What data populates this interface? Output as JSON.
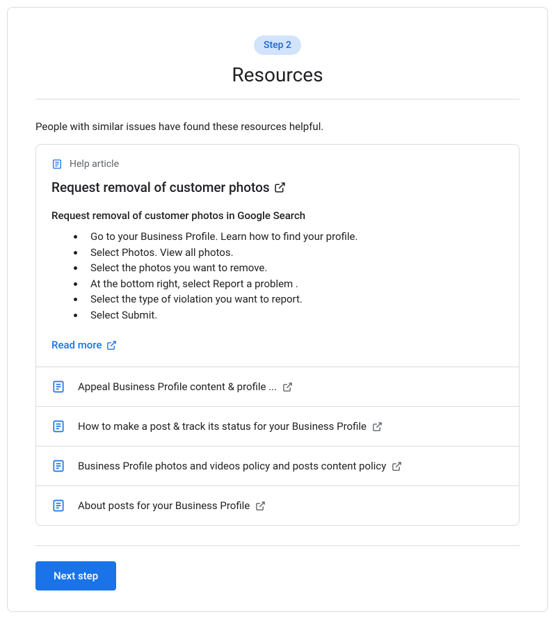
{
  "step_badge": "Step 2",
  "title": "Resources",
  "intro": "People with similar issues have found these resources helpful.",
  "featured": {
    "label": "Help article",
    "title": "Request removal of customer photos",
    "subtitle": "Request removal of customer photos in Google Search",
    "steps": [
      "Go to your Business Profile. Learn how to find your profile.",
      "Select Photos. View all photos.",
      "Select the photos you want to remove.",
      "At the bottom right, select Report a problem .",
      "Select the type of violation you want to report.",
      "Select Submit."
    ],
    "read_more": "Read more"
  },
  "articles": [
    {
      "title": "Appeal Business Profile content & profile ..."
    },
    {
      "title": "How to make a post & track its status for your Business Profile"
    },
    {
      "title": "Business Profile photos and videos policy and posts content policy"
    },
    {
      "title": "About posts for your Business Profile"
    }
  ],
  "next_button": "Next step"
}
